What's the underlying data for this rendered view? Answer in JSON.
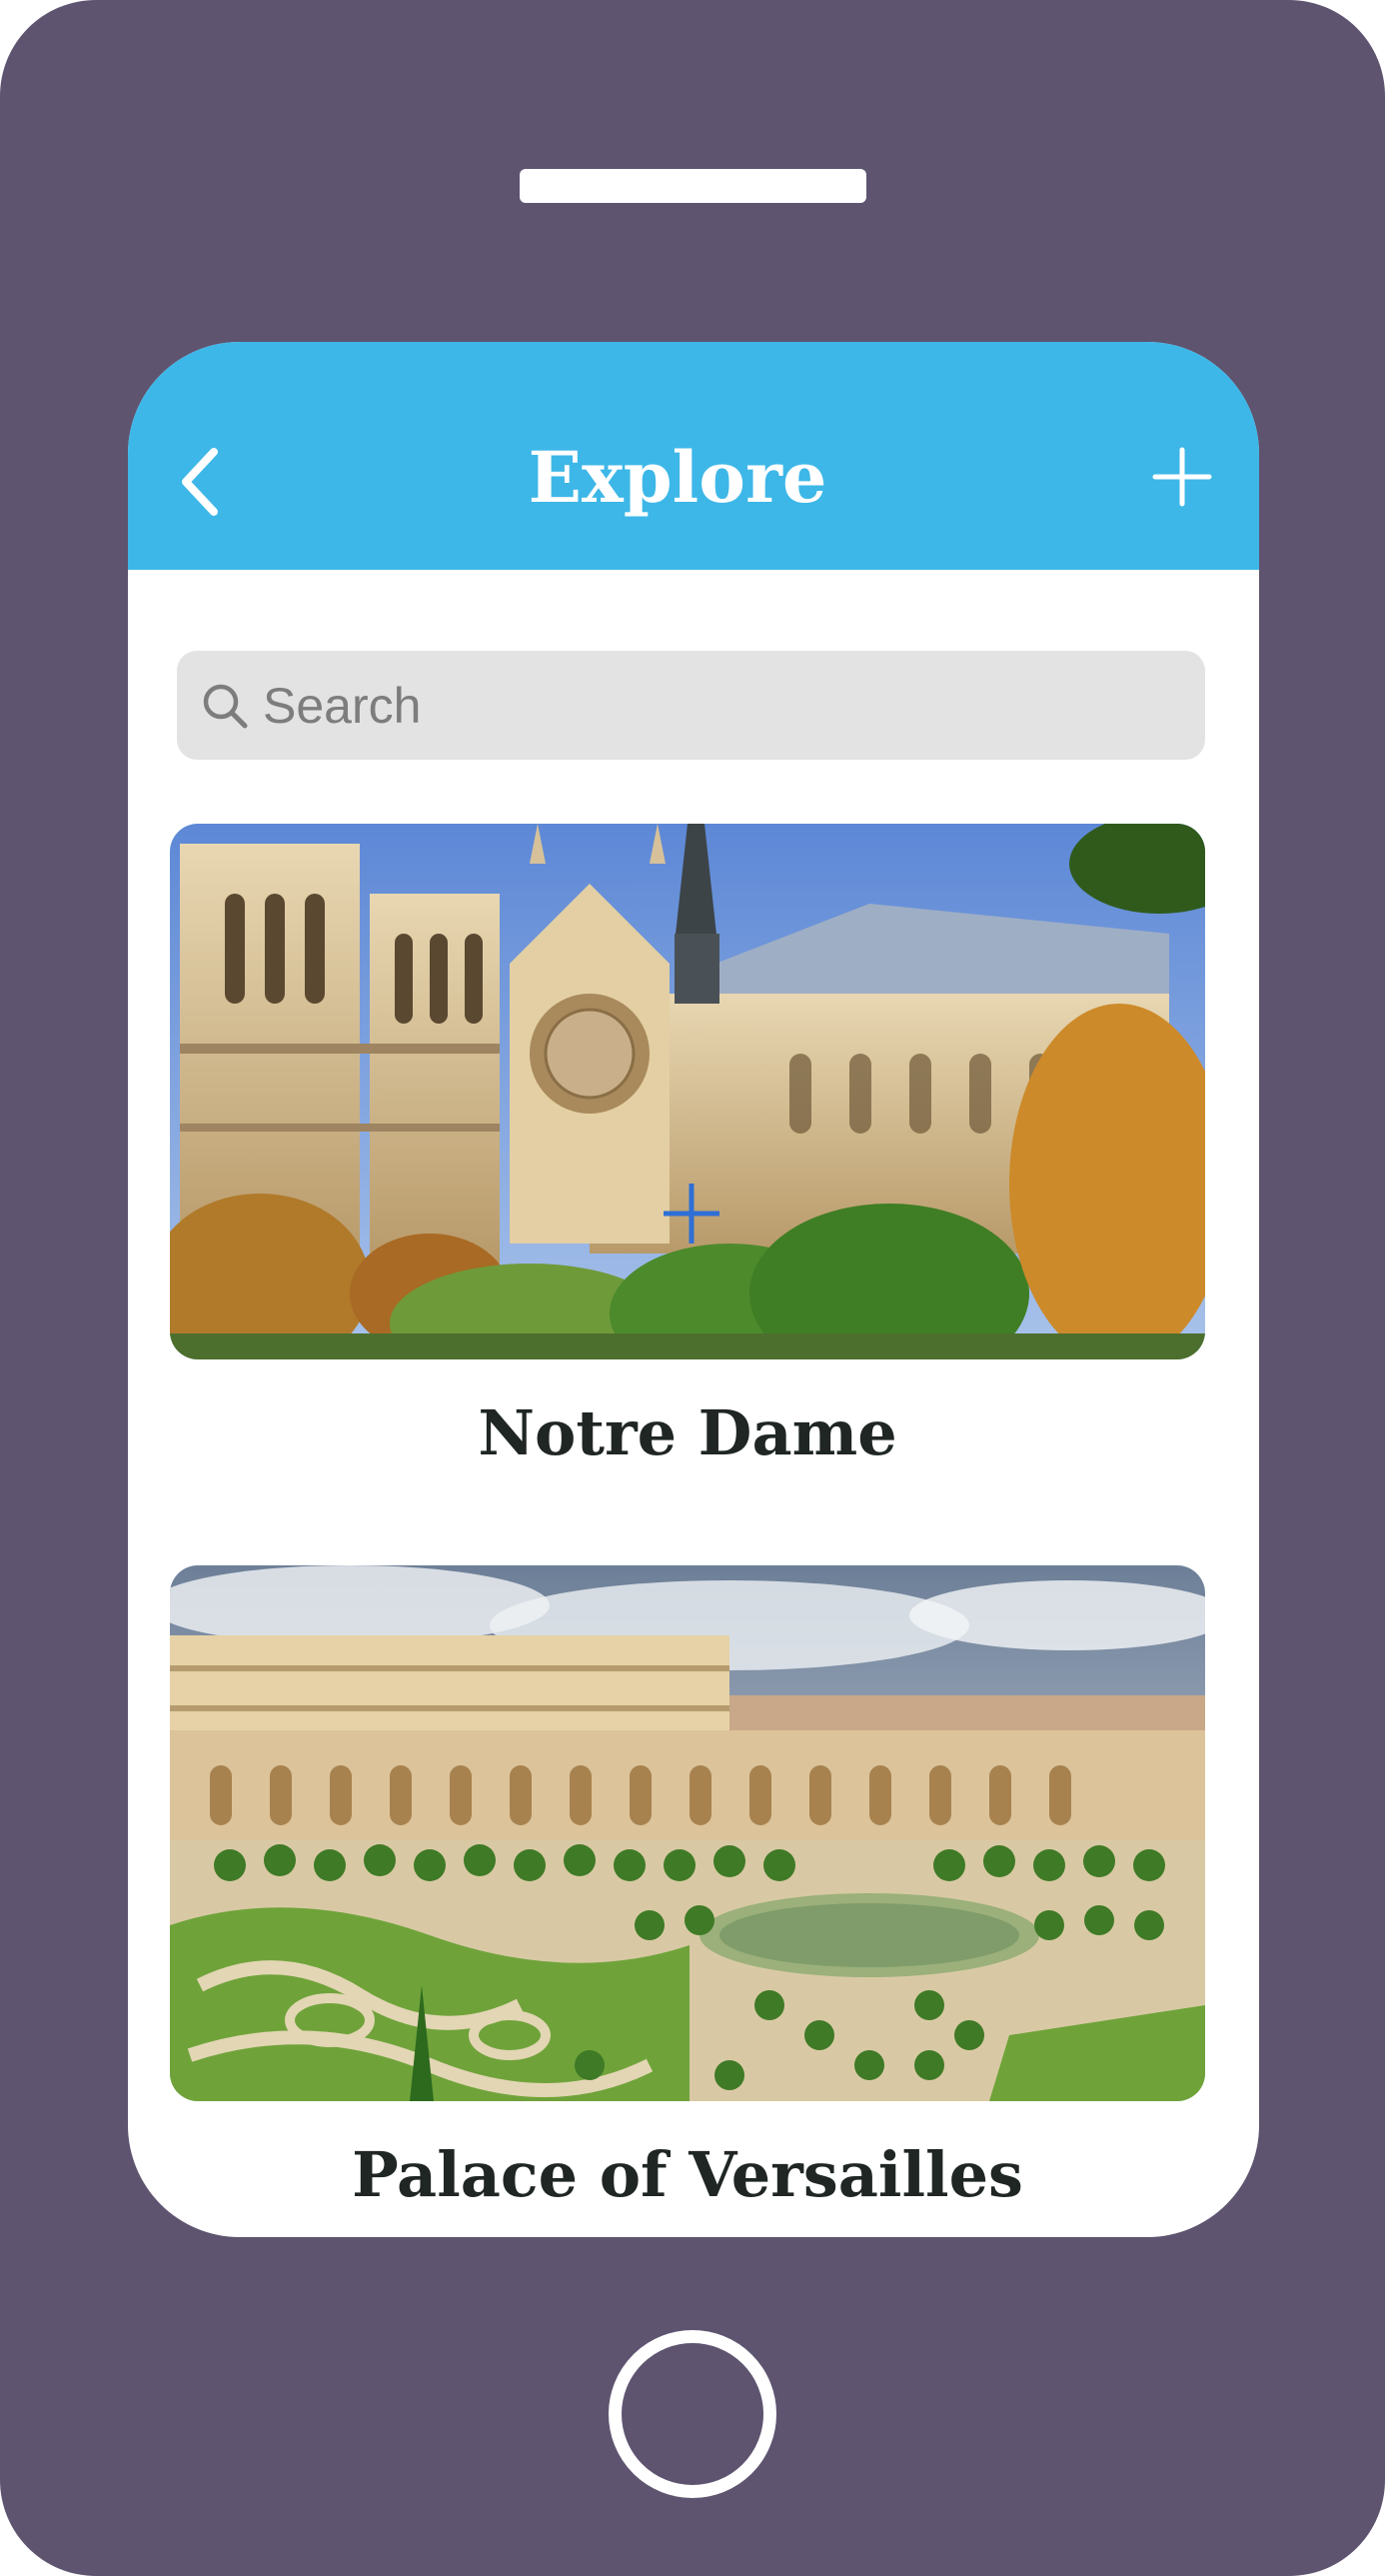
{
  "header": {
    "title": "Explore",
    "back_icon": "chevron-left-icon",
    "add_icon": "plus-icon",
    "color": "#3db7e7"
  },
  "search": {
    "placeholder": "Search",
    "value": "",
    "icon": "search-icon"
  },
  "places": [
    {
      "name": "Notre Dame",
      "image": "photo of Notre-Dame cathedral"
    },
    {
      "name": "Palace of Versailles",
      "image": "photo of the Palace of Versailles gardens"
    }
  ],
  "device": {
    "frame_color": "#5e5470",
    "home_button_icon": "home-button-icon"
  }
}
